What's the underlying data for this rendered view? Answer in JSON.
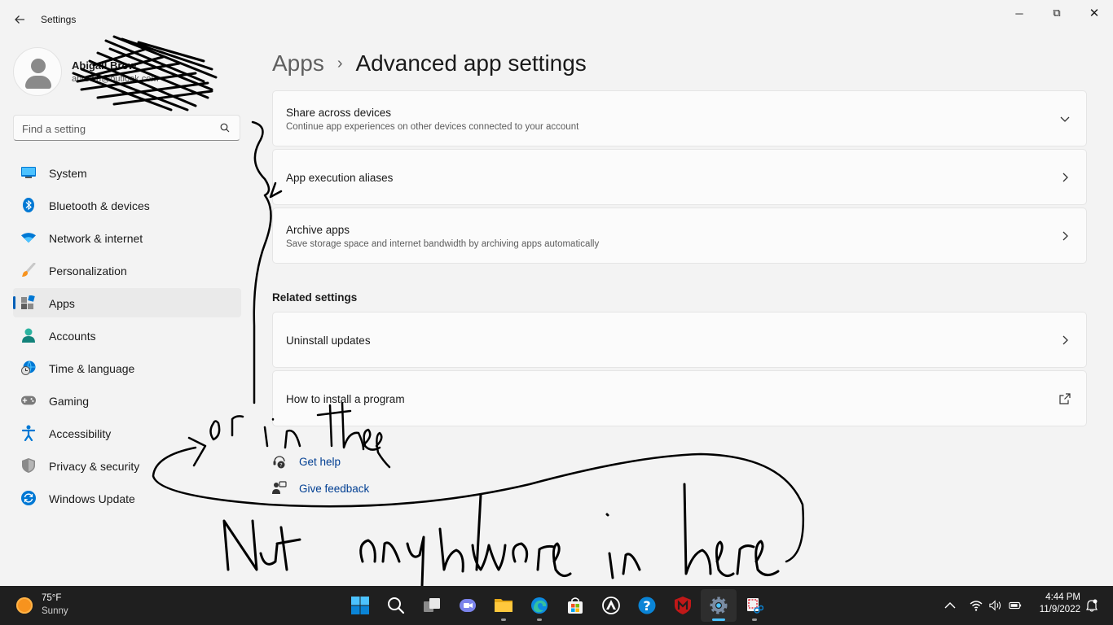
{
  "window": {
    "app_title": "Settings",
    "minimize_symbol": "─",
    "maximize_symbol": "⧉",
    "close_symbol": "✕"
  },
  "profile": {
    "name": "Abigail Brow",
    "email": "abrown@outlook.com"
  },
  "search": {
    "placeholder": "Find a setting"
  },
  "sidebar": {
    "items": [
      {
        "label": "System",
        "icon": "monitor-icon"
      },
      {
        "label": "Bluetooth & devices",
        "icon": "bluetooth-icon"
      },
      {
        "label": "Network & internet",
        "icon": "wifi-icon"
      },
      {
        "label": "Personalization",
        "icon": "brush-icon"
      },
      {
        "label": "Apps",
        "icon": "apps-icon",
        "active": true
      },
      {
        "label": "Accounts",
        "icon": "person-icon"
      },
      {
        "label": "Time & language",
        "icon": "globe-clock-icon"
      },
      {
        "label": "Gaming",
        "icon": "gamepad-icon"
      },
      {
        "label": "Accessibility",
        "icon": "accessibility-icon"
      },
      {
        "label": "Privacy & security",
        "icon": "shield-icon"
      },
      {
        "label": "Windows Update",
        "icon": "update-icon"
      }
    ]
  },
  "breadcrumb": {
    "parent": "Apps",
    "separator": "›",
    "current": "Advanced app settings"
  },
  "settings": [
    {
      "title": "Share across devices",
      "subtitle": "Continue app experiences on other devices connected to your account",
      "action": "expand"
    },
    {
      "title": "App execution aliases",
      "subtitle": "",
      "action": "navigate"
    },
    {
      "title": "Archive apps",
      "subtitle": "Save storage space and internet bandwidth by archiving apps automatically",
      "action": "navigate"
    }
  ],
  "related": {
    "heading": "Related settings",
    "items": [
      {
        "title": "Uninstall updates",
        "action": "navigate"
      },
      {
        "title": "How to install a program",
        "action": "external"
      }
    ]
  },
  "help": {
    "get_help": "Get help",
    "give_feedback": "Give feedback"
  },
  "taskbar": {
    "weather_temp": "75°F",
    "weather_condition": "Sunny",
    "apps": [
      "start-icon",
      "search-icon",
      "task-view-icon",
      "teams-chat-icon",
      "file-explorer-icon",
      "edge-icon",
      "store-icon",
      "app-icon",
      "help-icon",
      "mcafee-icon",
      "settings-icon",
      "snipping-tool-icon"
    ],
    "active_app": "settings-icon",
    "time": "4:44 PM",
    "date": "11/9/2022"
  },
  "annotation": {
    "handwriting_1": "or in these",
    "handwriting_2": "Not anywhere in here",
    "ink_color": "#000000"
  },
  "colors": {
    "accent": "#005fb8",
    "link": "#003e92",
    "background": "#f3f3f3",
    "card": "#fbfbfb",
    "taskbar": "#1f1f1f"
  }
}
